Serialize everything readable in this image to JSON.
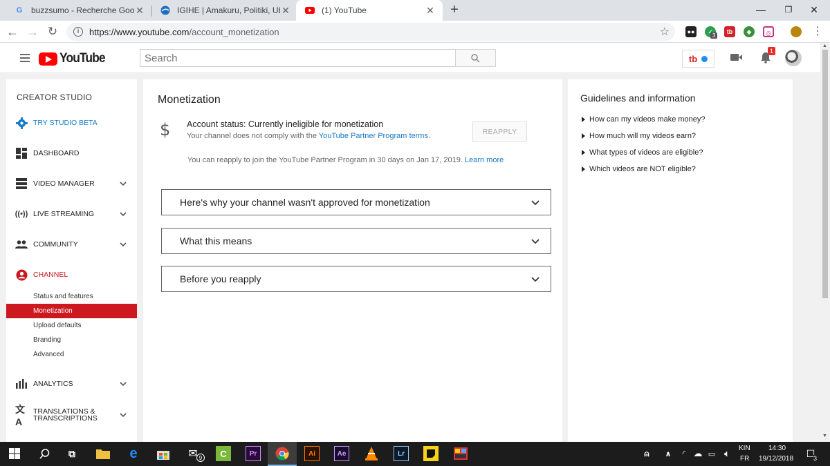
{
  "browser": {
    "tabs": [
      {
        "title": "buzzsumo - Recherche Google",
        "favicon": "google-icon",
        "active": false
      },
      {
        "title": "IGIHE | Amakuru, Politiki, Ubukungu",
        "favicon": "igihe-icon",
        "active": false
      },
      {
        "title": "(1) YouTube",
        "favicon": "youtube-icon",
        "active": true
      }
    ],
    "url_host": "https://www.youtube.com",
    "url_path": "/account_monetization",
    "ext_badge": "3"
  },
  "masthead": {
    "brand": "YouTube",
    "search_placeholder": "Search",
    "tb_label": "tb",
    "notification_count": "1"
  },
  "sidebar": {
    "header": "CREATOR STUDIO",
    "items": [
      {
        "label": "TRY STUDIO BETA",
        "icon": "gear-icon",
        "chevron": false
      },
      {
        "label": "DASHBOARD",
        "icon": "dashboard-icon",
        "chevron": false
      },
      {
        "label": "VIDEO MANAGER",
        "icon": "video-manager-icon",
        "chevron": true
      },
      {
        "label": "LIVE STREAMING",
        "icon": "live-streaming-icon",
        "chevron": true
      },
      {
        "label": "COMMUNITY",
        "icon": "community-icon",
        "chevron": true
      },
      {
        "label": "CHANNEL",
        "icon": "channel-icon",
        "chevron": false
      },
      {
        "label": "ANALYTICS",
        "icon": "analytics-icon",
        "chevron": true
      },
      {
        "label": "TRANSLATIONS & TRANSCRIPTIONS",
        "icon": "translate-icon",
        "chevron": true
      }
    ],
    "channel_subitems": [
      "Status and features",
      "Monetization",
      "Upload defaults",
      "Branding",
      "Advanced"
    ],
    "selected_subitem": "Monetization"
  },
  "main": {
    "title": "Monetization",
    "status_label": "Account status: Currently ineligible for monetization",
    "status_sub_prefix": "Your channel does not comply with the",
    "status_sub_link": "YouTube Partner Program terms",
    "reapply_button": "REAPPLY",
    "reapply_note": "You can reapply to join the YouTube Partner Program in 30 days on Jan 17, 2019.",
    "learn_more": "Learn more",
    "accordions": [
      "Here's why your channel wasn't approved for monetization",
      "What this means",
      "Before you reapply"
    ]
  },
  "guidelines": {
    "title": "Guidelines and information",
    "items": [
      "How can my videos make money?",
      "How much will my videos earn?",
      "What types of videos are eligible?",
      "Which videos are NOT eligible?"
    ]
  },
  "taskbar": {
    "mail_badge": "9",
    "lang_top": "KIN",
    "lang_bottom": "FR",
    "time": "14:30",
    "date": "19/12/2018",
    "notification_count": "3"
  },
  "colors": {
    "youtube_red": "#ff0000",
    "studio_red": "#cc181e",
    "link_blue": "#167ac6"
  }
}
